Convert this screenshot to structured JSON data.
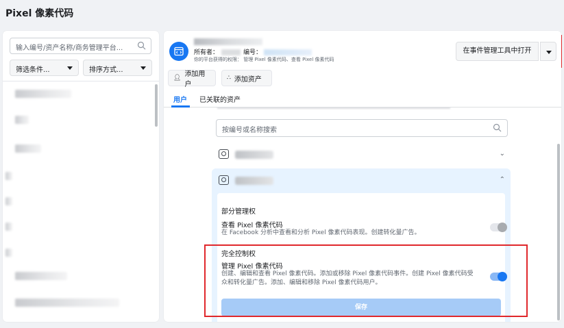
{
  "page_title": "Pixel 像素代码",
  "left_panel": {
    "search_placeholder": "输入编号/资产名称/商务管理平台...",
    "filter_label": "筛选条件...",
    "sort_label": "排序方式..."
  },
  "header": {
    "owner_label": "所有者：",
    "id_label": "编号：",
    "permission_text": "你的平台获得的权限：  管理 Pixel 像素代码、查看 Pixel 像素代码",
    "add_user_label": "添加用户",
    "add_asset_label": "添加资产",
    "open_in_events_manager": "在事件管理工具中打开",
    "tabs": [
      {
        "label": "用户",
        "active": true
      },
      {
        "label": "已关联的资产",
        "active": false
      }
    ]
  },
  "users_section": {
    "search_placeholder": "按编号或名称搜索"
  },
  "permissions": {
    "partial": {
      "title": "部分管理权",
      "item_title": "查看 Pixel 像素代码",
      "item_desc": "在 Facebook 分析中查看和分析 Pixel 像素代码表现。创建转化量广告。",
      "enabled": false
    },
    "full": {
      "title": "完全控制权",
      "item_title": "管理 Pixel 像素代码",
      "item_desc": "创建、编辑和查看 Pixel 像素代码。添加或移除 Pixel 像素代码事件。创建 Pixel 像素代码受众和转化量广告。添加、编辑和移除 Pixel 像素代码用户。",
      "enabled": true
    },
    "save_label": "保存"
  },
  "colors": {
    "accent": "#1877f2",
    "highlight_box": "#e0272b"
  }
}
